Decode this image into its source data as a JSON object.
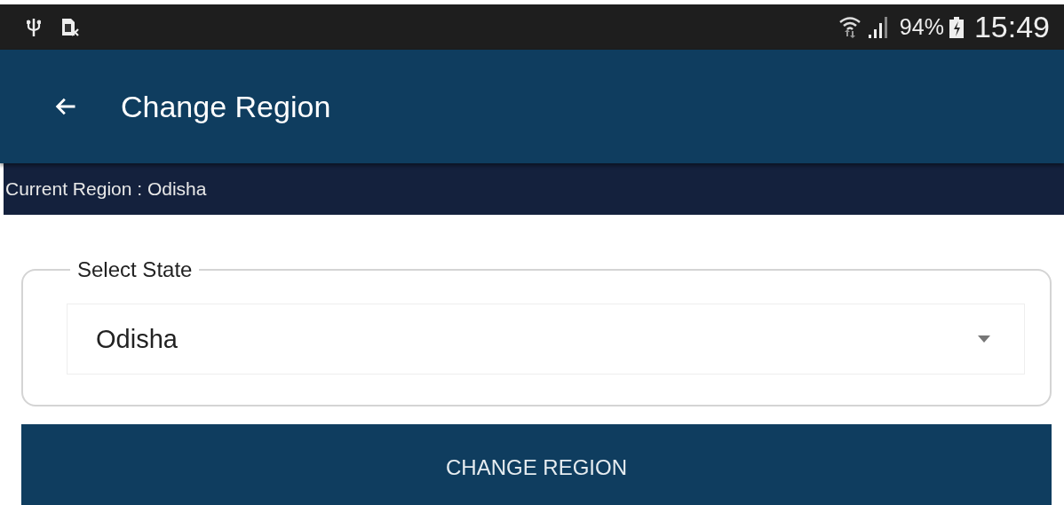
{
  "status_bar": {
    "battery": "94%",
    "time": "15:49"
  },
  "app_bar": {
    "title": "Change Region"
  },
  "current_region": "Current Region : Odisha",
  "state_select": {
    "legend": "Select State",
    "value": "Odisha"
  },
  "button": "CHANGE REGION"
}
